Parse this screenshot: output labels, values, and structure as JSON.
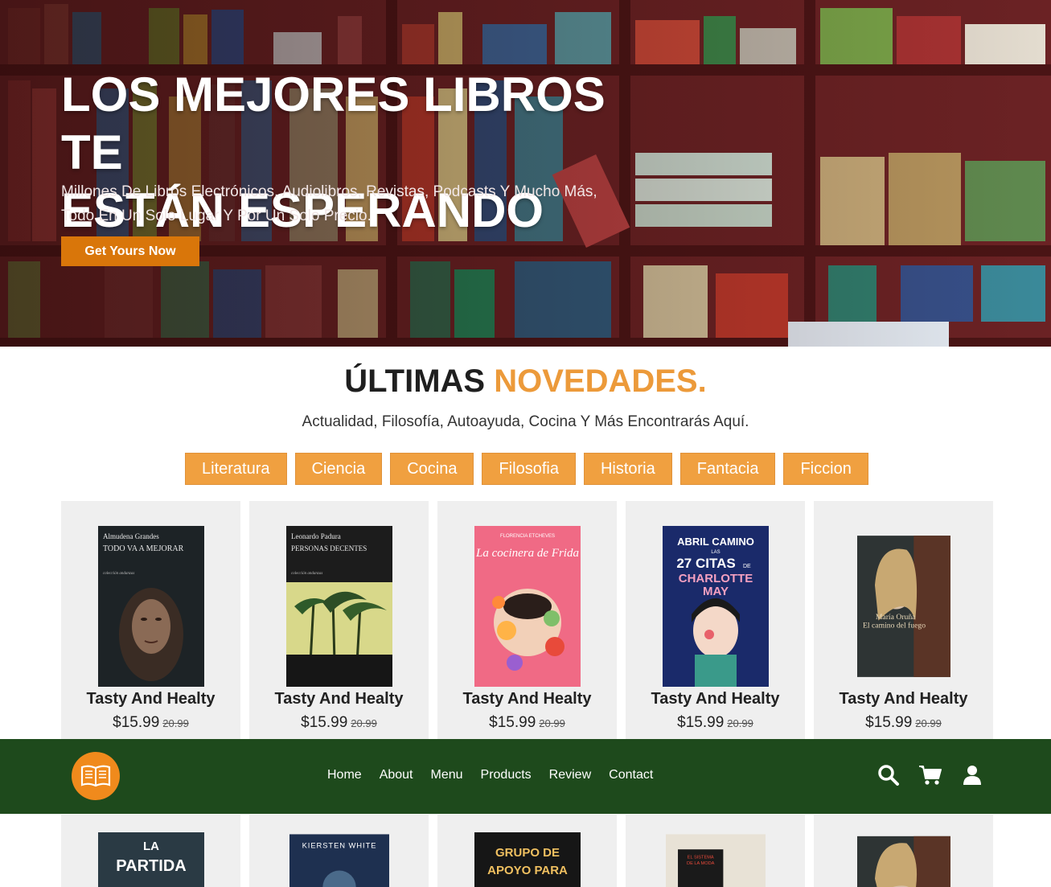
{
  "hero": {
    "title_line1": "LOS MEJORES LIBROS TE",
    "title_line2": "ESTÁN ESPERANDO",
    "subtitle_line1": "Millones De Libros Electrónicos, Audiolibros, Revistas, Podcasts Y Mucho Más,",
    "subtitle_line2": "Todo En Un Solo Lugar Y Por Un Solo Precio.",
    "cta_label": "Get Yours Now"
  },
  "section": {
    "title_main": "ÚLTIMAS ",
    "title_accent": "NOVEDADES.",
    "subtitle": "Actualidad, Filosofía, Autoayuda, Cocina Y Más Encontrarás Aquí."
  },
  "categories": [
    "Literatura",
    "Ciencia",
    "Cocina",
    "Filosofia",
    "Historia",
    "Fantacia",
    "Ficcion"
  ],
  "products": [
    {
      "name": "Tasty And Healty",
      "price": "$15.99",
      "old_price": "20.99",
      "cover": {
        "author": "Almudena Grandes",
        "title": "TODO VA A MEJORAR",
        "series": "colección andanzas"
      }
    },
    {
      "name": "Tasty And Healty",
      "price": "$15.99",
      "old_price": "20.99",
      "cover": {
        "author": "Leonardo Padura",
        "title": "PERSONAS DECENTES",
        "series": "colección andanzas"
      }
    },
    {
      "name": "Tasty And Healty",
      "price": "$15.99",
      "old_price": "20.99",
      "cover": {
        "author": "FLORENCIA ETCHEVES",
        "title": "La cocinera de Frida"
      }
    },
    {
      "name": "Tasty And Healty",
      "price": "$15.99",
      "old_price": "20.99",
      "cover": {
        "author": "ABRIL CAMINO",
        "title_small": "LAS",
        "title_big": "27 CITAS",
        "title_de": "DE",
        "title_name": "CHARLOTTE",
        "title_name2": "MAY"
      }
    },
    {
      "name": "Tasty And Healty",
      "price": "$15.99",
      "old_price": "20.99",
      "cover": {
        "author": "María Oruña",
        "title": "El camino del fuego"
      }
    }
  ],
  "products_row2": [
    {
      "cover_text1": "LA",
      "cover_text2": "PARTIDA"
    },
    {
      "cover_text1": "KIERSTEN WHITE"
    },
    {
      "cover_text1": "GRUPO DE",
      "cover_text2": "APOYO PARA"
    },
    {
      "cover_text1": "EL SISTEMA",
      "cover_text2": "DE LA MODA"
    },
    {}
  ],
  "nav": {
    "items": [
      "Home",
      "About",
      "Menu",
      "Products",
      "Review",
      "Contact"
    ],
    "icons": [
      "search-icon",
      "cart-icon",
      "user-icon"
    ],
    "logo_icon": "open-book-icon"
  },
  "colors": {
    "accent": "#ec9a3a",
    "cta": "#d9760a",
    "nav_bg": "#1e4a1c",
    "card_bg": "#efefef"
  }
}
